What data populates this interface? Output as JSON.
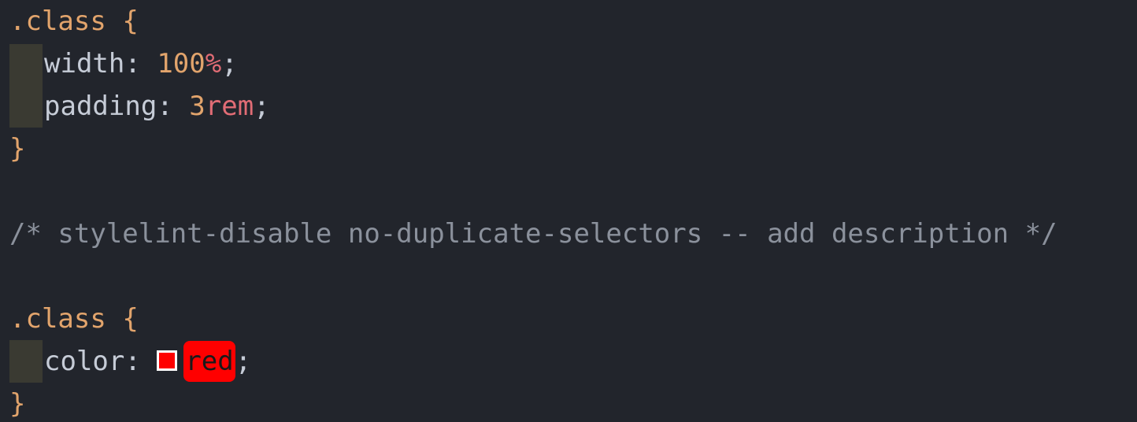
{
  "lines": {
    "l1_selector": ".class",
    "l1_brace": "{",
    "l2_prop": "width",
    "l2_colon": ":",
    "l2_number": "100",
    "l2_unit": "%",
    "l2_semi": ";",
    "l3_prop": "padding",
    "l3_colon": ":",
    "l3_number": "3",
    "l3_unit": "rem",
    "l3_semi": ";",
    "l4_brace": "}",
    "l6_comment": "/* stylelint-disable no-duplicate-selectors -- add description */",
    "l8_selector": ".class",
    "l8_brace": "{",
    "l9_prop": "color",
    "l9_colon": ":",
    "l9_value": "red",
    "l9_semi": ";",
    "l10_brace": "}"
  },
  "colors": {
    "background": "#22252c",
    "selector": "#e2a46c",
    "number": "#e2a46c",
    "unit": "#e16c75",
    "comment": "#8b919c",
    "text": "#c6ccd7",
    "swatch": "#ff0000"
  },
  "icons": {
    "color_swatch": "color-swatch-icon"
  }
}
